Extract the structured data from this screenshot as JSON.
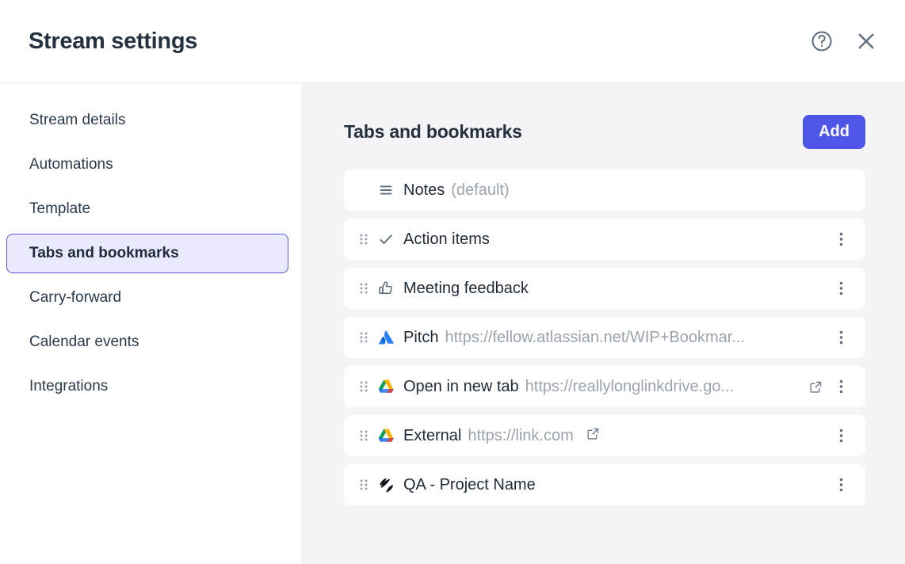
{
  "header": {
    "title": "Stream settings",
    "help_icon": "help-circle-icon",
    "close_icon": "close-icon"
  },
  "sidebar": {
    "items": [
      {
        "label": "Stream details",
        "active": false
      },
      {
        "label": "Automations",
        "active": false
      },
      {
        "label": "Template",
        "active": false
      },
      {
        "label": "Tabs and bookmarks",
        "active": true
      },
      {
        "label": "Carry-forward",
        "active": false
      },
      {
        "label": "Calendar events",
        "active": false
      },
      {
        "label": "Integrations",
        "active": false
      }
    ]
  },
  "main": {
    "title": "Tabs and bookmarks",
    "add_label": "Add",
    "add_color": "#4f55e6",
    "rows": [
      {
        "label": "Notes",
        "sub": "(default)",
        "icon": "notes-lines-icon",
        "draggable": false,
        "external": false,
        "menu": false
      },
      {
        "label": "Action items",
        "sub": "",
        "icon": "check-icon",
        "draggable": true,
        "external": false,
        "menu": true
      },
      {
        "label": "Meeting feedback",
        "sub": "",
        "icon": "thumbs-up-icon",
        "draggable": true,
        "external": false,
        "menu": true
      },
      {
        "label": "Pitch",
        "sub": "https://fellow.atlassian.net/WIP+Bookmar...",
        "icon": "atlassian-icon",
        "draggable": true,
        "external": false,
        "menu": true
      },
      {
        "label": "Open in new tab",
        "sub": "https://reallylonglinkdrive.go...",
        "icon": "google-drive-icon",
        "draggable": true,
        "external": true,
        "menu": true
      },
      {
        "label": "External",
        "sub": "https://link.com",
        "icon": "google-drive-icon",
        "draggable": true,
        "external": true,
        "menu": true
      },
      {
        "label": "QA - Project Name",
        "sub": "",
        "icon": "fathom-icon",
        "draggable": true,
        "external": false,
        "menu": true
      }
    ]
  }
}
